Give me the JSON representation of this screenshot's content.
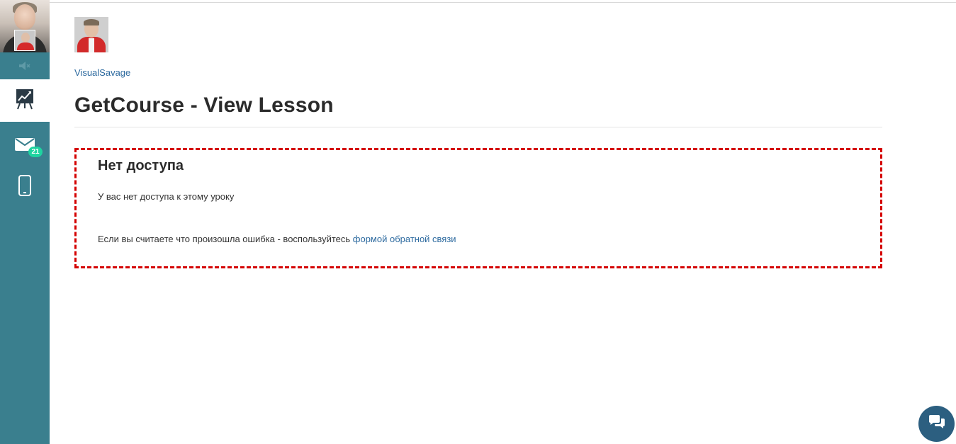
{
  "sidebar": {
    "user_avatar_icon": "user-avatar-photo",
    "volume_icon": "speaker-muted-icon",
    "active_item_icon": "trainings-chart-icon",
    "mail_icon": "envelope-icon",
    "mail_badge": "21",
    "phone_icon": "mobile-phone-icon",
    "background_color": "#3a7f8e",
    "badge_color": "#1ed4a0"
  },
  "header": {
    "author_name": "VisualSavage",
    "page_title": "GetCourse - View Lesson"
  },
  "notice": {
    "title": "Нет доступа",
    "message": "У вас нет доступа к этому уроку",
    "hint_prefix": "Если вы считаете что произошла ошибка - воспользуйтесь ",
    "hint_link": "формой обратной связи",
    "border_color": "#d40000"
  },
  "chat": {
    "icon": "chat-bubbles-icon",
    "color": "#2c5f80"
  },
  "link_color": "#2d6a9f"
}
